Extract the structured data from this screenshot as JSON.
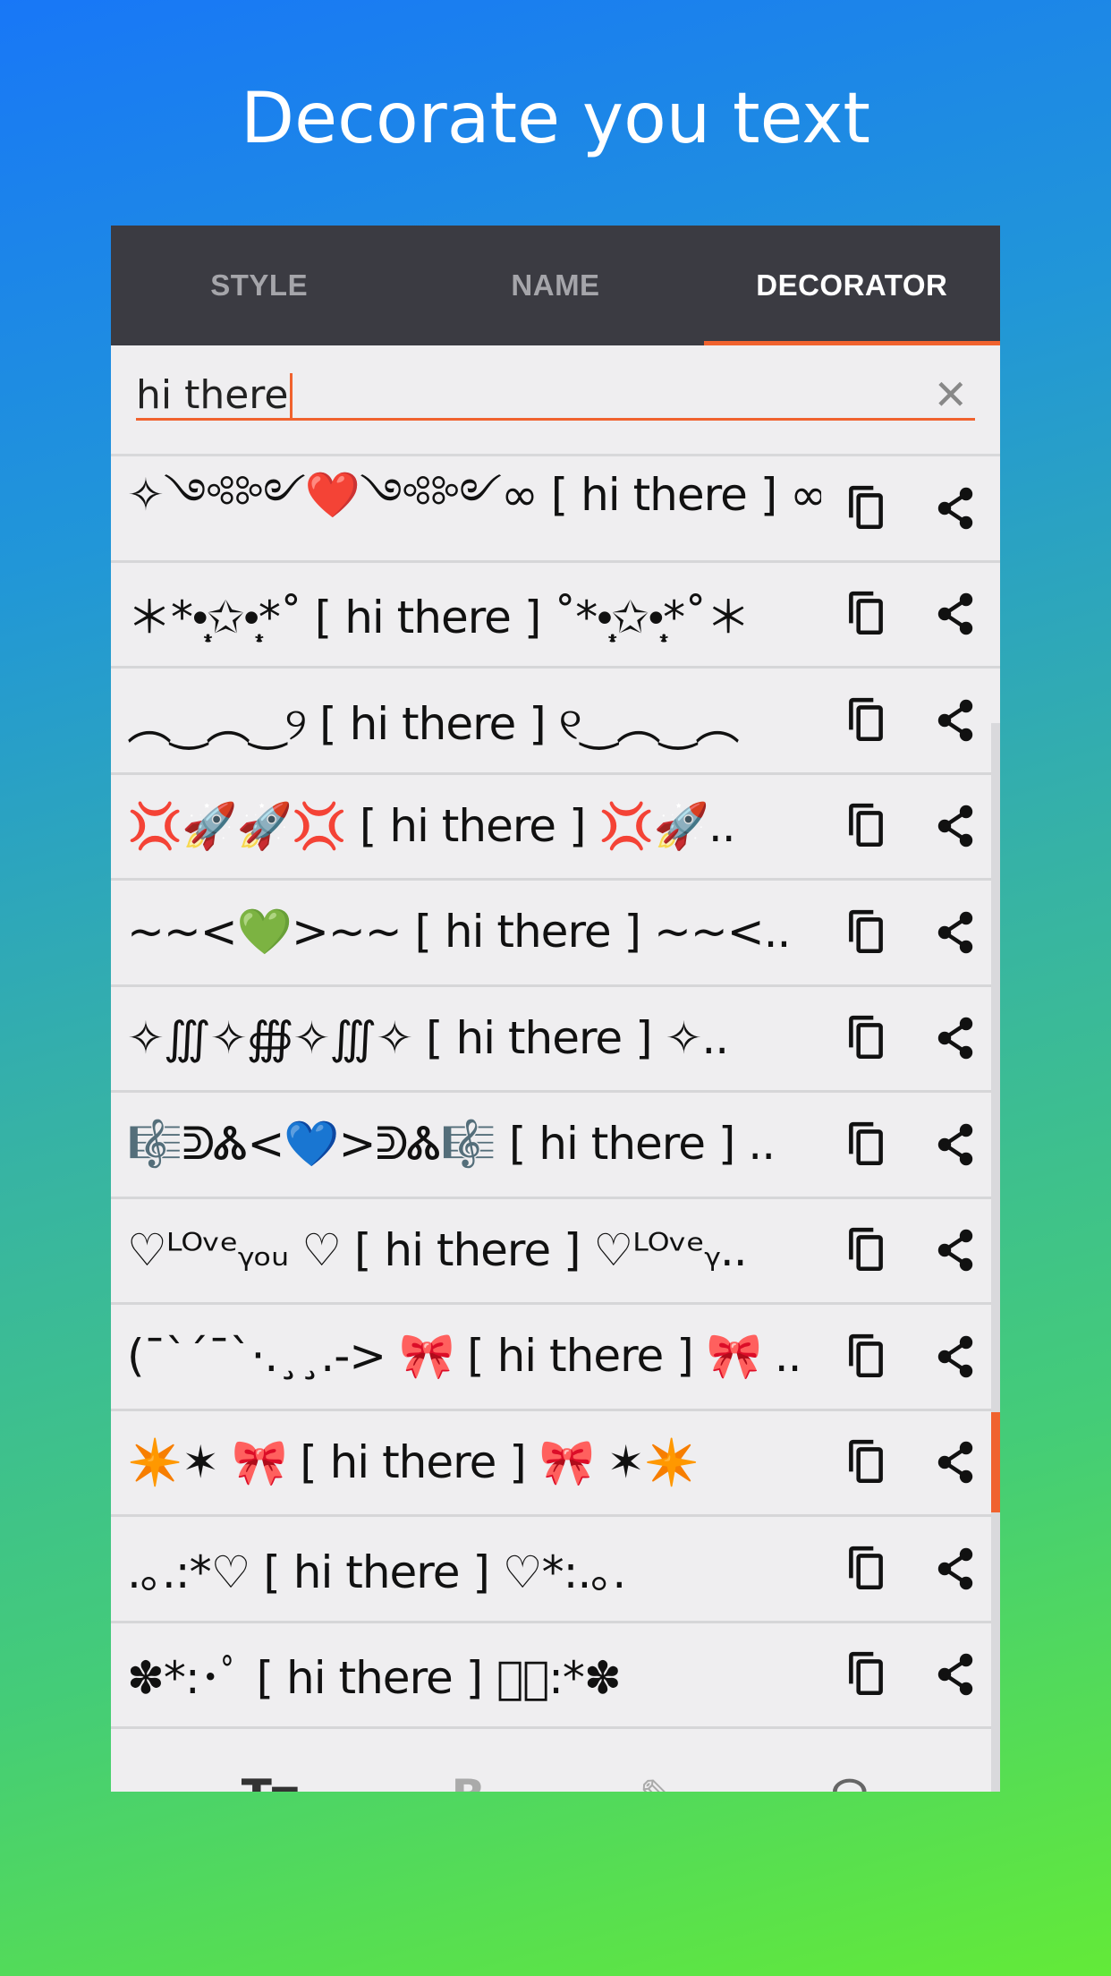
{
  "headline": "Decorate you text",
  "tabs": [
    {
      "label": "STYLE"
    },
    {
      "label": "NAME"
    },
    {
      "label": "DECORATOR",
      "active": true
    }
  ],
  "input": {
    "value": "hi there"
  },
  "accent": "#f0622e",
  "rows": [
    "✧༺༻❤️༺༻∞ [ hi there ] ∞༺༻..",
    "＊*•̩̩͙✩•̩̩͙*˚ [ hi there ] ˚*•̩̩͙✩•̩̩͙*˚＊",
    "︵‿︵‿୨ [ hi there ] ୧‿︵‿︵",
    "💢🚀🚀💢 [ hi there ] 💢🚀..",
    "~~<💚>~~ [ hi there ] ~~<..",
    "✧∭✧∰✧∭✧ [ hi there ] ✧..",
    "🎼ᕲᏜ<💙>ᕲᏜ🎼 [ hi there ] ..",
    "♡ᴸᴼᵛᵉᵧₒᵤ ♡ [ hi there ] ♡ᴸᴼᵛᵉᵧ..",
    "(¯`´¯`·.¸¸.-> 🎀 [ hi there ] 🎀 ..",
    "✴️✶ 🎀 [ hi there ] 🎀 ✶✴️",
    ".｡.:*♡ [ hi there ] ♡*:.｡.",
    "✽*:･ﾟ [ hi there ] ﾟ･:*✽"
  ],
  "bottom_nav": [
    "Tт",
    "B",
    "✎",
    "☊"
  ]
}
